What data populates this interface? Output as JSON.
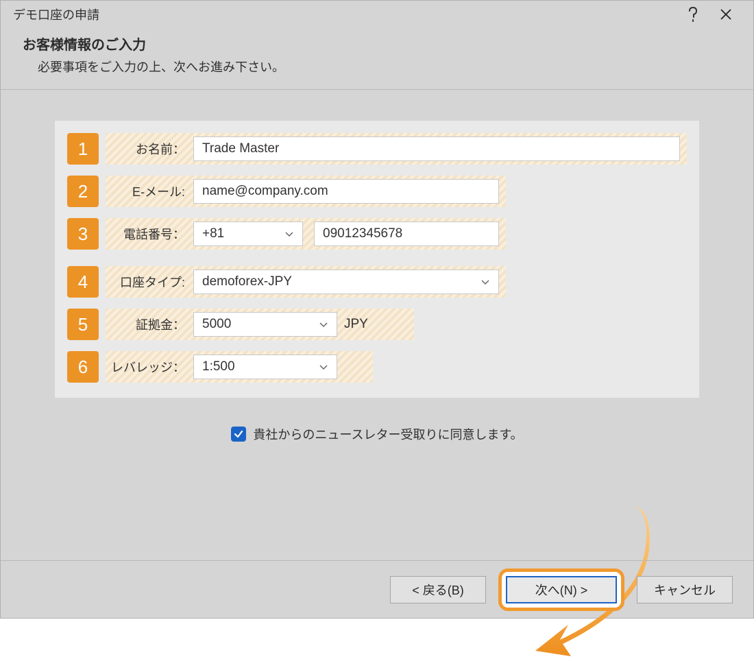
{
  "window": {
    "title": "デモ口座の申請"
  },
  "header": {
    "title": "お客様情報のご入力",
    "subtitle": "必要事項をご入力の上、次へお進み下さい。"
  },
  "form": {
    "fields": {
      "name": {
        "num": "1",
        "label": "お名前：",
        "value": "Trade Master"
      },
      "email": {
        "num": "2",
        "label": "E-メール:",
        "value": "name@company.com"
      },
      "phone": {
        "num": "3",
        "label": "電話番号：",
        "cc": "+81",
        "number": "09012345678"
      },
      "account": {
        "num": "4",
        "label": "口座タイプ:",
        "value": "demoforex-JPY"
      },
      "deposit": {
        "num": "5",
        "label": "証拠金：",
        "value": "5000",
        "currency": "JPY"
      },
      "leverage": {
        "num": "6",
        "label": "レバレッジ：",
        "value": "1:500"
      }
    }
  },
  "consent": {
    "label": "貴社からのニュースレター受取りに同意します。",
    "checked": true
  },
  "footer": {
    "back": "< 戻る(B)",
    "next": "次へ(N) >",
    "cancel": "キャンセル"
  }
}
